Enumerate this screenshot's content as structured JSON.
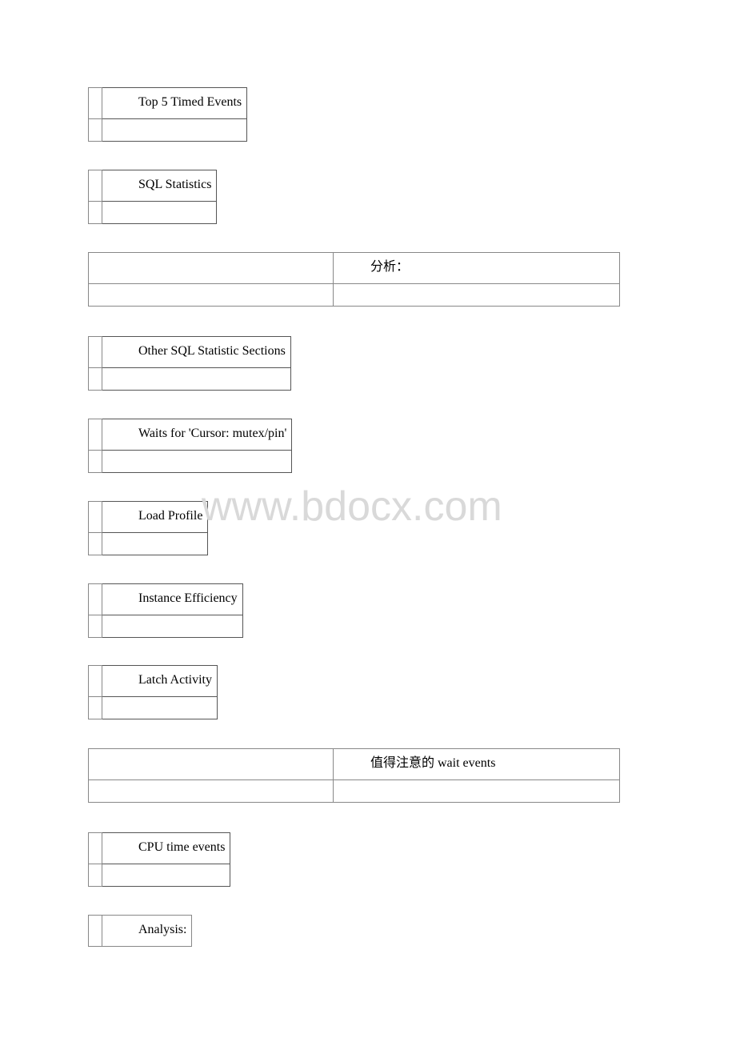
{
  "sections": [
    {
      "title": "Top 5 Timed Events"
    },
    {
      "title": "SQL Statistics"
    },
    {
      "title": "分析："
    },
    {
      "title": "Other SQL Statistic Sections"
    },
    {
      "title": "Waits for 'Cursor: mutex/pin'"
    },
    {
      "title": "Load Profile"
    },
    {
      "title": "Instance Efficiency"
    },
    {
      "title": "Latch Activity"
    },
    {
      "title": "值得注意的 wait events"
    },
    {
      "title": "CPU time events"
    },
    {
      "title": "Analysis:"
    }
  ],
  "watermark": "www.bdocx.com"
}
